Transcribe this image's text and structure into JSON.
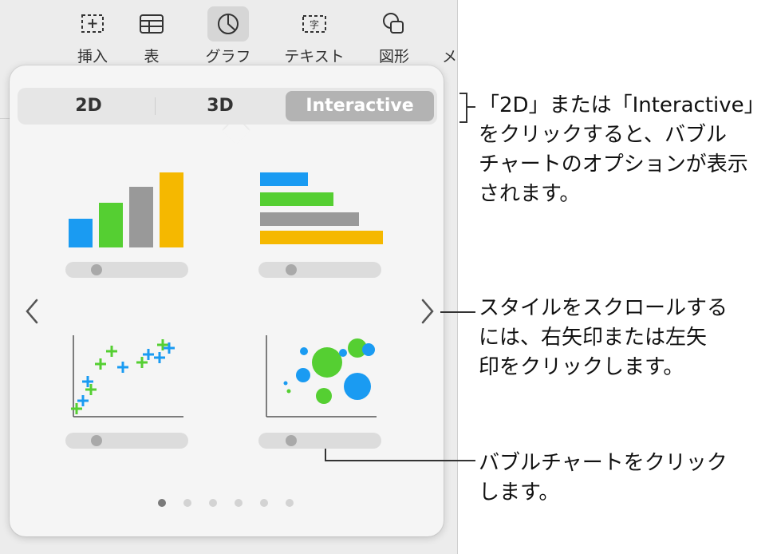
{
  "toolbar": {
    "items": [
      {
        "label": "挿入",
        "icon": "insert-icon"
      },
      {
        "label": "表",
        "icon": "table-icon"
      },
      {
        "label": "グラフ",
        "icon": "chart-icon"
      },
      {
        "label": "テキスト",
        "icon": "text-icon"
      },
      {
        "label": "図形",
        "icon": "shape-icon"
      }
    ],
    "more_label": "メ"
  },
  "popover": {
    "tabs": [
      {
        "label": "2D"
      },
      {
        "label": "3D"
      },
      {
        "label": "Interactive"
      }
    ],
    "selected_tab": "Interactive",
    "charts": [
      {
        "name": "column-chart",
        "icon": "column-chart-icon"
      },
      {
        "name": "bar-chart",
        "icon": "bar-chart-icon"
      },
      {
        "name": "scatter-chart",
        "icon": "scatter-chart-icon"
      },
      {
        "name": "bubble-chart",
        "icon": "bubble-chart-icon"
      }
    ],
    "page_count": 6,
    "current_page": 1
  },
  "colors": {
    "blue": "#1a9bf2",
    "green": "#55cf32",
    "gray": "#999999",
    "yellow": "#f5b800",
    "selected_segment": "#b3b3b3",
    "popover_bg": "#f5f5f5"
  },
  "callouts": {
    "tabs": "「2D」または「Interactive」\nをクリックすると、バブル\nチャートのオプションが表示\nされます。",
    "arrows": "スタイルをスクロールする\nには、右矢印または左矢\n印をクリックします。",
    "bubble": "バブルチャートをクリック\nします。"
  }
}
